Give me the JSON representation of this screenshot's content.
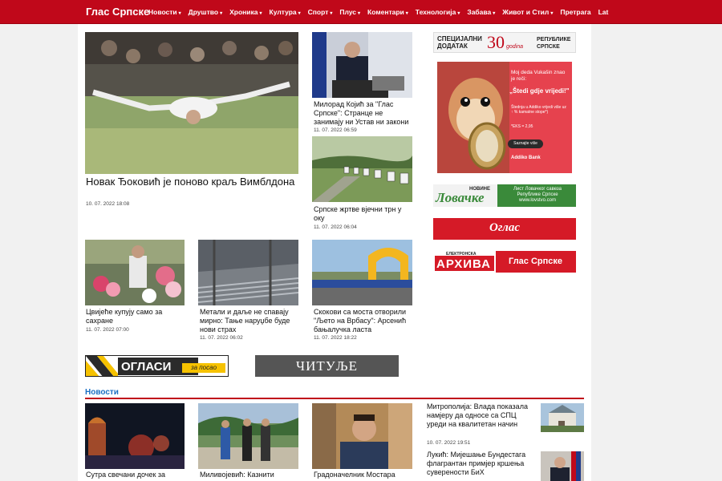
{
  "brand": "Глас Српске",
  "nav": [
    {
      "label": "Новости",
      "dropdown": true
    },
    {
      "label": "Друштво",
      "dropdown": true
    },
    {
      "label": "Хроника",
      "dropdown": true
    },
    {
      "label": "Култура",
      "dropdown": true
    },
    {
      "label": "Спорт",
      "dropdown": true
    },
    {
      "label": "Плус",
      "dropdown": true
    },
    {
      "label": "Коментари",
      "dropdown": true
    },
    {
      "label": "Технологија",
      "dropdown": true
    },
    {
      "label": "Забава",
      "dropdown": true
    },
    {
      "label": "Живот и Стил",
      "dropdown": true
    },
    {
      "label": "Претрага",
      "dropdown": false
    },
    {
      "label": "Lat",
      "dropdown": false
    }
  ],
  "articles": {
    "main": {
      "title": "Новак Ђоковић је поново краљ Вимблдона",
      "date": "10. 07. 2022 18:08"
    },
    "kojic": {
      "title": "Милорад Којић за \"Глас Српске\": Странце не занимају ни Устав ни закони",
      "date": "11. 07. 2022 06:59"
    },
    "zrtve": {
      "title": "Српске жртве вјечни трн у оку",
      "date": "11. 07. 2022 06:04"
    },
    "cvijece": {
      "title": "Цвијеће купују само за сахране",
      "date": "11. 07. 2022 07:00"
    },
    "metal": {
      "title": "Метали и даље не спавају мирно: Тање наруџбе буде нови страх",
      "date": "11. 07. 2022 06:02"
    },
    "skokovi": {
      "title": "Скокови са моста отворили \"Љето на Врбасу\": Арсенић бањалучка ласта",
      "date": "11. 07. 2022 18:22"
    }
  },
  "ads": {
    "specijalni_line1": "СПЕЦИЈАЛНИ",
    "specijalni_line2": "ДОДАТАК",
    "specijalni_num": "30",
    "specijalni_godina": "godina",
    "specijalni_right1": "РЕПУБЛИКЕ",
    "specijalni_right2": "СРПСКЕ",
    "addiko_quote": "Moj deda Vukašin znao je reči:",
    "addiko_slogan": "„Štedi gdje vrijedi!\"",
    "addiko_text": "Štednja u Addiko vrijedi više uz ↑ % kamatne stope*)",
    "addiko_badge": "*EKS = 2,95",
    "addiko_btn": "Saznajte više",
    "addiko_bank": "Addiko Bank",
    "lovacke_novine": "НОВИНЕ",
    "lovacke_title": "Ловачке",
    "lovacke_sub1": "Лист Ловачког савеза",
    "lovacke_sub2": "Републике Српске",
    "lovacke_url": "www.lovstvo.com",
    "oglas": "Оглас",
    "arhiva_small": "ЕЛЕКТРОНСКА",
    "arhiva_big": "АРХИВА",
    "arhiva_brand": "Глас Српске",
    "oglasi": "ОГЛАСИ",
    "oglasi_posao": "за посао",
    "citulje": "ЧИТУЉЕ"
  },
  "section": {
    "title": "Новости"
  },
  "news": {
    "n1": {
      "title": "Сутра свечани дочек за"
    },
    "n2": {
      "title": "Миливојевић: Казнити"
    },
    "n3": {
      "title": "Градоначелник Мостара"
    },
    "side1": {
      "title": "Митрополија: Влада показала намјеру да односе са СПЦ уреди на квалитетан начин",
      "date": "10. 07. 2022 19:51"
    },
    "side2": {
      "title": "Лукић: Мијешање Бундестага флагрантан примјер кршења суверености БиХ"
    }
  },
  "colors": {
    "brand_red": "#c0081a",
    "link_blue": "#1a6fc3",
    "lovacke_green": "#3a8a3a"
  }
}
